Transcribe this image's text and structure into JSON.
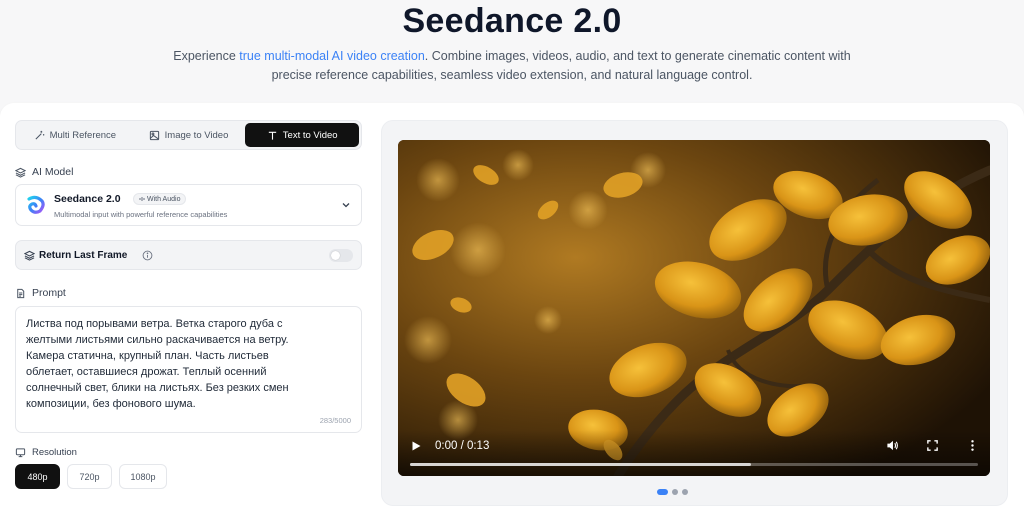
{
  "hero": {
    "title": "Seedance 2.0",
    "subtitle_pre": "Experience ",
    "subtitle_accent": "true multi-modal AI video creation",
    "subtitle_post": ". Combine images, videos, audio, and text to generate cinematic content with precise reference capabilities, seamless video extension, and natural language control."
  },
  "tabs": [
    {
      "label": "Multi Reference",
      "icon": "wand-icon",
      "active": false
    },
    {
      "label": "Image to Video",
      "icon": "image-icon",
      "active": false
    },
    {
      "label": "Text to Video",
      "icon": "text-icon",
      "active": true
    }
  ],
  "model": {
    "section_label": "AI Model",
    "name": "Seedance 2.0",
    "badge": "With Audio",
    "description": "Multimodal input with powerful reference capabilities"
  },
  "return_last_frame": {
    "label": "Return Last Frame",
    "enabled": false
  },
  "prompt": {
    "section_label": "Prompt",
    "text": "Листва под порывами ветра. Ветка старого дуба с\nжелтыми листьями сильно раскачивается на ветру.\nКамера статична, крупный план. Часть листьев\nоблетает, оставшиеся дрожат. Теплый осенний\nсолнечный свет, блики на листьях. Без резких смен\nкомпозиции, без фонового шума.",
    "char_count": "283/5000"
  },
  "resolution": {
    "section_label": "Resolution",
    "options": [
      "480p",
      "720p",
      "1080p"
    ],
    "selected": "480p"
  },
  "video": {
    "time": "0:00 / 0:13",
    "buffered": 0.6,
    "carousel_total": 3,
    "carousel_active": 0
  },
  "colors": {
    "accent": "#3b82f6",
    "active_tab": "#111111"
  }
}
